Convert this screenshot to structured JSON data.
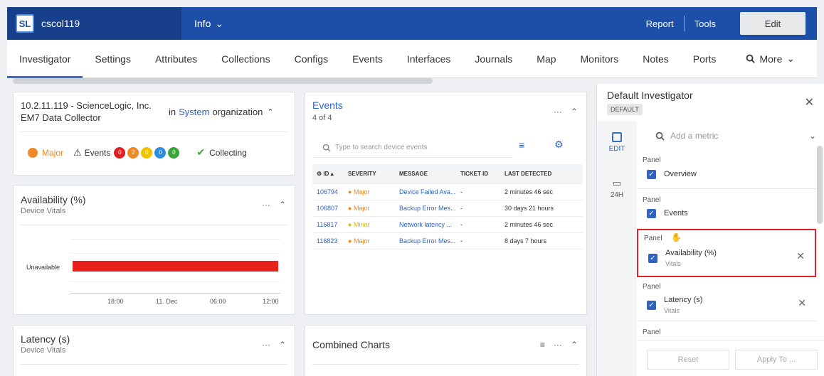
{
  "topbar": {
    "logo": "SL",
    "device_name": "cscol119",
    "info_label": "Info",
    "report": "Report",
    "tools": "Tools",
    "edit": "Edit"
  },
  "tabs": [
    "Investigator",
    "Settings",
    "Attributes",
    "Collections",
    "Configs",
    "Events",
    "Interfaces",
    "Journals",
    "Map",
    "Monitors",
    "Notes",
    "Ports"
  ],
  "more_label": "More",
  "device_card": {
    "title_line1": "10.2.11.119 - ScienceLogic, Inc.",
    "title_line2": "EM7 Data Collector",
    "in_text": "in",
    "org_link": "System",
    "org_suffix": "organization",
    "status": "Major",
    "events_label": "Events",
    "badges": [
      {
        "count": "0",
        "color": "#e02020"
      },
      {
        "count": "2",
        "color": "#f08a24"
      },
      {
        "count": "0",
        "color": "#f2c200"
      },
      {
        "count": "0",
        "color": "#2a8de0"
      },
      {
        "count": "0",
        "color": "#3aa63a"
      }
    ],
    "collecting": "Collecting"
  },
  "availability": {
    "title": "Availability (%)",
    "subtitle": "Device Vitals",
    "bar_label": "Unavailable",
    "x_ticks": [
      "18:00",
      "11. Dec",
      "06:00",
      "12:00"
    ]
  },
  "latency": {
    "title": "Latency (s)",
    "subtitle": "Device Vitals"
  },
  "events": {
    "title": "Events",
    "count": "4 of 4",
    "search_placeholder": "Type to search device events",
    "columns": [
      "ID",
      "SEVERITY",
      "MESSAGE",
      "TICKET ID",
      "LAST DETECTED"
    ],
    "rows": [
      {
        "id": "106794",
        "severity": "Major",
        "sev_color": "#f08a24",
        "message": "Device Failed Ava...",
        "ticket": "-",
        "last": "2 minutes 46 sec"
      },
      {
        "id": "106807",
        "severity": "Major",
        "sev_color": "#f08a24",
        "message": "Backup Error Mes...",
        "ticket": "-",
        "last": "30 days 21 hours"
      },
      {
        "id": "116817",
        "severity": "Minor",
        "sev_color": "#f2c200",
        "message": "Network latency ...",
        "ticket": "-",
        "last": "2 minutes 46 sec"
      },
      {
        "id": "116823",
        "severity": "Major",
        "sev_color": "#f08a24",
        "message": "Backup Error Mes...",
        "ticket": "-",
        "last": "8 days 7 hours"
      }
    ]
  },
  "combined": {
    "title": "Combined Charts"
  },
  "right_panel": {
    "title": "Default Investigator",
    "pill": "DEFAULT",
    "side_edit": "EDIT",
    "side_24h": "24H",
    "metric_placeholder": "Add a metric",
    "panel_label": "Panel",
    "panels": [
      {
        "name": "Overview",
        "sub": ""
      },
      {
        "name": "Events",
        "sub": ""
      },
      {
        "name": "Availability (%)",
        "sub": "Vitals"
      },
      {
        "name": "Latency (s)",
        "sub": "Vitals"
      }
    ],
    "reset": "Reset",
    "apply": "Apply To ..."
  },
  "colors": {
    "brand": "#1e4fa8",
    "major": "#f08a24",
    "unavailable": "#e8201c",
    "highlight": "#d9262c"
  }
}
